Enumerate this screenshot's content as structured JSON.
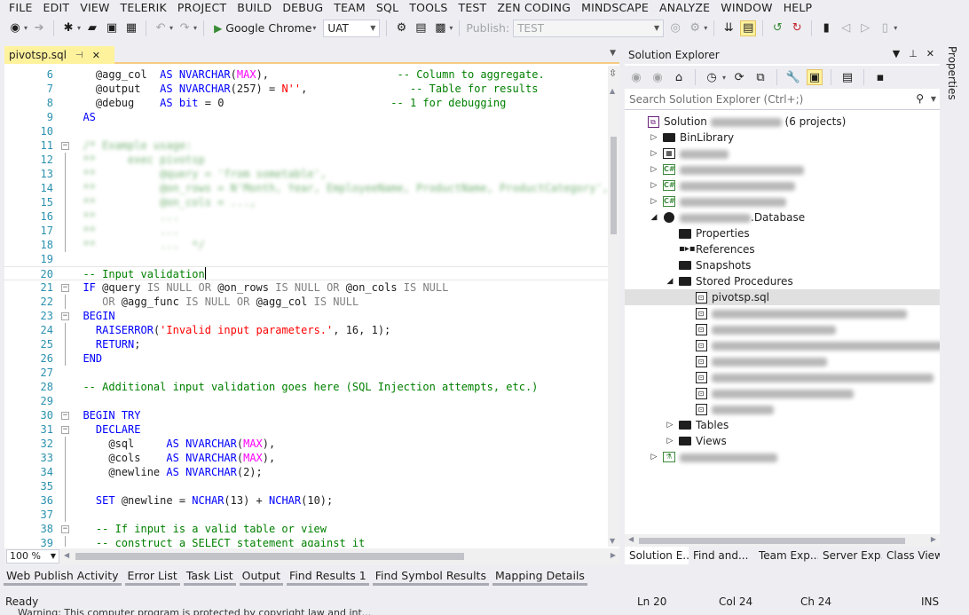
{
  "menu": [
    "FILE",
    "EDIT",
    "VIEW",
    "TELERIK",
    "PROJECT",
    "BUILD",
    "DEBUG",
    "TEAM",
    "SQL",
    "TOOLS",
    "TEST",
    "ZEN CODING",
    "MINDSCAPE",
    "ANALYZE",
    "WINDOW",
    "HELP"
  ],
  "toolbar": {
    "run_label": "Google Chrome",
    "config_value": "UAT",
    "publish_label": "Publish:",
    "publish_value": "TEST"
  },
  "editor": {
    "tab_title": "pivotsp.sql",
    "zoom": "100 %",
    "lines": [
      {
        "n": "6",
        "fold": "",
        "html": "    <span>@agg_col</span>  <span class='kw'>AS</span> <span class='kw'>NVARCHAR</span>(<span class='ty'>MAX</span>),                    <span class='cm'>-- Column to aggregate.</span>"
      },
      {
        "n": "7",
        "fold": "",
        "html": "    @output   <span class='kw'>AS</span> <span class='kw'>NVARCHAR</span>(257) = <span class='st'>N''</span>,                <span class='cm'>-- Table for results</span>"
      },
      {
        "n": "8",
        "fold": "",
        "html": "    @debug    <span class='kw'>AS</span> <span class='kw'>bit</span> = 0                          <span class='cm'>-- 1 for debugging</span>"
      },
      {
        "n": "9",
        "fold": "",
        "html": "  <span class='kw'>AS</span>"
      },
      {
        "n": "10",
        "fold": "",
        "html": ""
      },
      {
        "n": "11",
        "fold": "box",
        "html": "<span class='blurred'>  /* Example usage:</span>"
      },
      {
        "n": "12",
        "fold": "bar",
        "html": "<span class='blurred'>  **     exec pivotsp</span>"
      },
      {
        "n": "13",
        "fold": "bar",
        "html": "<span class='blurred'>  **          @query = 'from sometable',</span>"
      },
      {
        "n": "14",
        "fold": "bar",
        "html": "<span class='blurred'>  **          @on_rows = N'Month, Year, EmployeeName, ProductName, ProductCategory',</span>"
      },
      {
        "n": "15",
        "fold": "bar",
        "html": "<span class='blurred'>  **          @on_cols = ...,</span>"
      },
      {
        "n": "16",
        "fold": "bar",
        "html": "<span class='blurred'>  **          ...</span>"
      },
      {
        "n": "17",
        "fold": "bar",
        "html": "<span class='blurred'>  **          ...</span>"
      },
      {
        "n": "18",
        "fold": "bar",
        "html": "<span class='blurred'>  **          ...  */</span>"
      },
      {
        "n": "19",
        "fold": "",
        "html": ""
      },
      {
        "n": "20",
        "fold": "",
        "html": "  <span class='cm'>-- Input validation</span>",
        "current": true
      },
      {
        "n": "21",
        "fold": "box",
        "html": "  <span class='kw'>IF</span> @query <span class='gr'>IS</span> <span class='gr'>NULL</span> <span class='gr'>OR</span> @on_rows <span class='gr'>IS</span> <span class='gr'>NULL</span> <span class='gr'>OR</span> @on_cols <span class='gr'>IS</span> <span class='gr'>NULL</span>"
      },
      {
        "n": "22",
        "fold": "bar",
        "html": "     <span class='gr'>OR</span> @agg_func <span class='gr'>IS</span> <span class='gr'>NULL</span> <span class='gr'>OR</span> @agg_col <span class='gr'>IS</span> <span class='gr'>NULL</span>"
      },
      {
        "n": "23",
        "fold": "box",
        "html": "  <span class='kw'>BEGIN</span>"
      },
      {
        "n": "24",
        "fold": "bar",
        "html": "    <span class='kw'>RAISERROR</span>(<span class='st'>'Invalid input parameters.'</span>, 16, 1);"
      },
      {
        "n": "25",
        "fold": "bar",
        "html": "    <span class='kw'>RETURN</span>;"
      },
      {
        "n": "26",
        "fold": "bar",
        "html": "  <span class='kw'>END</span>"
      },
      {
        "n": "27",
        "fold": "",
        "html": ""
      },
      {
        "n": "28",
        "fold": "",
        "html": "  <span class='cm'>-- Additional input validation goes here (SQL Injection attempts, etc.)</span>"
      },
      {
        "n": "29",
        "fold": "",
        "html": ""
      },
      {
        "n": "30",
        "fold": "box",
        "html": "  <span class='kw'>BEGIN</span> <span class='kw'>TRY</span>"
      },
      {
        "n": "31",
        "fold": "box",
        "html": "    <span class='kw'>DECLARE</span>"
      },
      {
        "n": "32",
        "fold": "bar",
        "html": "      @sql     <span class='kw'>AS</span> <span class='kw'>NVARCHAR</span>(<span class='ty'>MAX</span>),"
      },
      {
        "n": "33",
        "fold": "bar",
        "html": "      @cols    <span class='kw'>AS</span> <span class='kw'>NVARCHAR</span>(<span class='ty'>MAX</span>),"
      },
      {
        "n": "34",
        "fold": "bar",
        "html": "      @newline <span class='kw'>AS</span> <span class='kw'>NVARCHAR</span>(2);"
      },
      {
        "n": "35",
        "fold": "bar",
        "html": ""
      },
      {
        "n": "36",
        "fold": "bar",
        "html": "    <span class='kw'>SET</span> @newline = <span class='kw'>NCHAR</span>(13) + <span class='kw'>NCHAR</span>(10);"
      },
      {
        "n": "37",
        "fold": "bar",
        "html": ""
      },
      {
        "n": "38",
        "fold": "box",
        "html": "    <span class='cm'>-- If input is a valid table or view</span>"
      },
      {
        "n": "39",
        "fold": "bar",
        "html": "    <span class='cm'>-- construct a SELECT statement against it</span>"
      }
    ]
  },
  "solution_explorer": {
    "title": "Solution Explorer",
    "search_placeholder": "Search Solution Explorer (Ctrl+;)",
    "tree": [
      {
        "depth": 0,
        "exp": "",
        "icon": "solution-icon",
        "label": "Solution",
        "blur": 80,
        "suffix": "(6 projects)"
      },
      {
        "depth": 1,
        "exp": "▷",
        "icon": "folder-icon",
        "label": "BinLibrary"
      },
      {
        "depth": 1,
        "exp": "▷",
        "icon": "web-project-icon",
        "label": "",
        "blur": 55
      },
      {
        "depth": 1,
        "exp": "▷",
        "icon": "csharp-project-icon",
        "label": "",
        "blur": 140
      },
      {
        "depth": 1,
        "exp": "▷",
        "icon": "csharp-project-icon",
        "label": "",
        "blur": 130
      },
      {
        "depth": 1,
        "exp": "▷",
        "icon": "csharp-project-icon",
        "label": "",
        "blur": 120
      },
      {
        "depth": 1,
        "exp": "◢",
        "icon": "database-project-icon",
        "label": ".Database",
        "blur": 80
      },
      {
        "depth": 2,
        "exp": "",
        "icon": "properties-icon",
        "label": "Properties"
      },
      {
        "depth": 2,
        "exp": "",
        "icon": "references-icon",
        "label": "References"
      },
      {
        "depth": 2,
        "exp": "",
        "icon": "folder-icon",
        "label": "Snapshots"
      },
      {
        "depth": 2,
        "exp": "◢",
        "icon": "folder-icon",
        "label": "Stored Procedures"
      },
      {
        "depth": 3,
        "exp": "",
        "icon": "sql-file-icon",
        "label": "pivotsp.sql",
        "selected": true
      },
      {
        "depth": 3,
        "exp": "",
        "icon": "sql-file-icon",
        "label": "",
        "blur": 220
      },
      {
        "depth": 3,
        "exp": "",
        "icon": "sql-file-icon",
        "label": "",
        "blur": 140
      },
      {
        "depth": 3,
        "exp": "",
        "icon": "sql-file-icon",
        "label": "",
        "blur": 270
      },
      {
        "depth": 3,
        "exp": "",
        "icon": "sql-file-icon",
        "label": "",
        "blur": 130
      },
      {
        "depth": 3,
        "exp": "",
        "icon": "sql-file-icon",
        "label": "",
        "blur": 250
      },
      {
        "depth": 3,
        "exp": "",
        "icon": "sql-file-icon",
        "label": "",
        "blur": 160
      },
      {
        "depth": 3,
        "exp": "",
        "icon": "sql-file-icon",
        "label": "",
        "blur": 70
      },
      {
        "depth": 2,
        "exp": "▷",
        "icon": "folder-icon",
        "label": "Tables"
      },
      {
        "depth": 2,
        "exp": "▷",
        "icon": "folder-icon",
        "label": "Views"
      },
      {
        "depth": 1,
        "exp": "▷",
        "icon": "test-project-icon",
        "label": "",
        "blur": 110
      }
    ],
    "tabs": [
      "Solution E...",
      "Find and...",
      "Team Exp...",
      "Server Exp...",
      "Class View"
    ]
  },
  "properties_strip": "Properties",
  "bottom_tabs": [
    "Web Publish Activity",
    "Error List",
    "Task List",
    "Output",
    "Find Results 1",
    "Find Symbol Results",
    "Mapping Details"
  ],
  "status": {
    "ready": "Ready",
    "ln": "Ln 20",
    "col": "Col 24",
    "ch": "Ch 24",
    "ins": "INS",
    "warning": "Warning: This computer program is protected by copyright law and int..."
  }
}
